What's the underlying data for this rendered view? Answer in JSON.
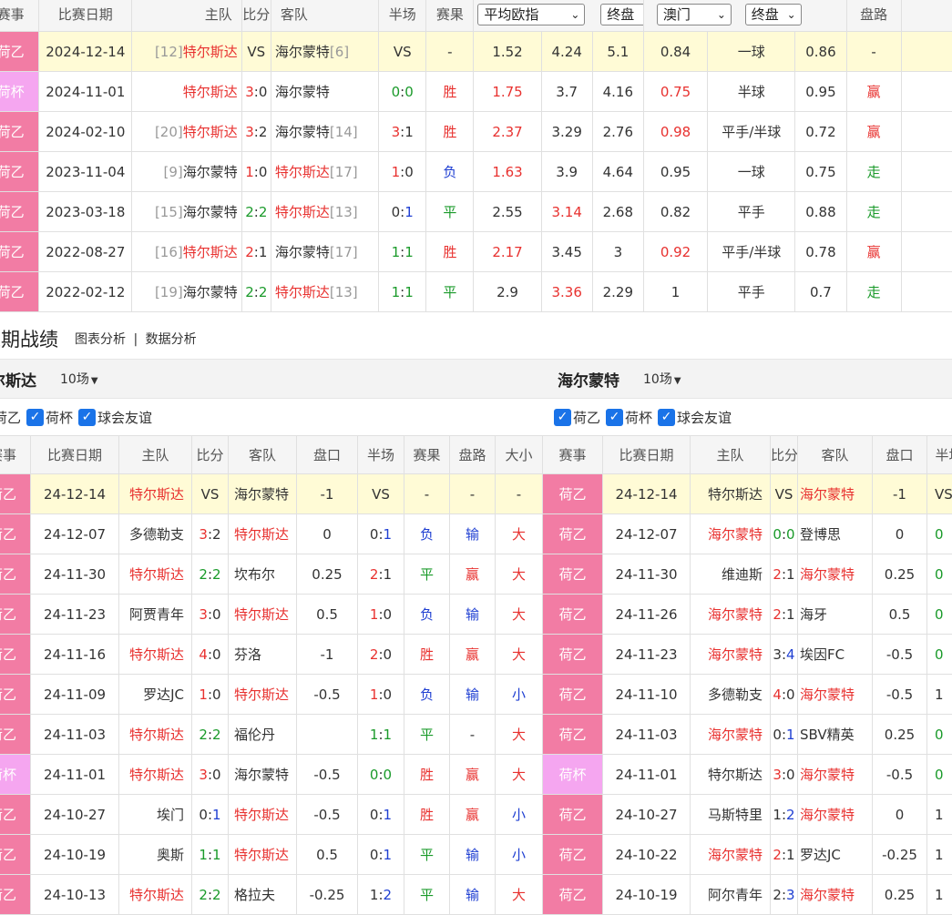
{
  "h2h": {
    "headers": {
      "league": "赛事",
      "date": "比赛日期",
      "home": "主队",
      "score": "比分",
      "away": "客队",
      "half": "半场",
      "result": "赛果",
      "odds_select": "平均欧指",
      "odds_type_select": "终盘",
      "company_select": "澳门",
      "handicap_type_select": "终盘",
      "trend": "盘路"
    },
    "rows": [
      {
        "league": "荷乙",
        "cup": false,
        "date": "2024-12-14",
        "home_rank": "[12]",
        "home": "特尔斯达",
        "home_red": true,
        "score_h": "VS",
        "score_a": "",
        "away": "海尔蒙特",
        "away_rank": "[6]",
        "away_red": false,
        "half": "VS",
        "half_h": "",
        "half_a": "",
        "result": "-",
        "result_c": "",
        "o1": "1.52",
        "o1c": "",
        "o2": "4.24",
        "o2c": "",
        "o3": "5.1",
        "o3c": "",
        "h1": "0.84",
        "h1c": "",
        "hcap": "一球",
        "h2": "0.86",
        "trend": "-",
        "trend_c": ""
      },
      {
        "league": "荷杯",
        "cup": true,
        "date": "2024-11-01",
        "home_rank": "",
        "home": "特尔斯达",
        "home_red": true,
        "score_h": "3",
        "score_a": "0",
        "away": "海尔蒙特",
        "away_rank": "",
        "away_red": false,
        "half": "",
        "half_h": "0",
        "half_a": "0",
        "result": "胜",
        "result_c": "red",
        "o1": "1.75",
        "o1c": "red",
        "o2": "3.7",
        "o2c": "",
        "o3": "4.16",
        "o3c": "",
        "h1": "0.75",
        "h1c": "red",
        "hcap": "半球",
        "h2": "0.95",
        "trend": "赢",
        "trend_c": "red"
      },
      {
        "league": "荷乙",
        "cup": false,
        "date": "2024-02-10",
        "home_rank": "[20]",
        "home": "特尔斯达",
        "home_red": true,
        "score_h": "3",
        "score_a": "2",
        "away": "海尔蒙特",
        "away_rank": "[14]",
        "away_red": false,
        "half": "",
        "half_h": "3",
        "half_a": "1",
        "result": "胜",
        "result_c": "red",
        "o1": "2.37",
        "o1c": "red",
        "o2": "3.29",
        "o2c": "",
        "o3": "2.76",
        "o3c": "",
        "h1": "0.98",
        "h1c": "red",
        "hcap": "平手/半球",
        "h2": "0.72",
        "trend": "赢",
        "trend_c": "red"
      },
      {
        "league": "荷乙",
        "cup": false,
        "date": "2023-11-04",
        "home_rank": "[9]",
        "home": "海尔蒙特",
        "home_red": false,
        "score_h": "1",
        "score_a": "0",
        "away": "特尔斯达",
        "away_rank": "[17]",
        "away_red": true,
        "half": "",
        "half_h": "1",
        "half_a": "0",
        "result": "负",
        "result_c": "blue",
        "o1": "1.63",
        "o1c": "red",
        "o2": "3.9",
        "o2c": "",
        "o3": "4.64",
        "o3c": "",
        "h1": "0.95",
        "h1c": "",
        "hcap": "一球",
        "h2": "0.75",
        "trend": "走",
        "trend_c": "green"
      },
      {
        "league": "荷乙",
        "cup": false,
        "date": "2023-03-18",
        "home_rank": "[15]",
        "home": "海尔蒙特",
        "home_red": false,
        "score_h": "2",
        "score_a": "2",
        "away": "特尔斯达",
        "away_rank": "[13]",
        "away_red": true,
        "half": "",
        "half_h": "0",
        "half_a": "1",
        "result": "平",
        "result_c": "green",
        "o1": "2.55",
        "o1c": "",
        "o2": "3.14",
        "o2c": "red",
        "o3": "2.68",
        "o3c": "",
        "h1": "0.82",
        "h1c": "",
        "hcap": "平手",
        "h2": "0.88",
        "trend": "走",
        "trend_c": "green"
      },
      {
        "league": "荷乙",
        "cup": false,
        "date": "2022-08-27",
        "home_rank": "[16]",
        "home": "特尔斯达",
        "home_red": true,
        "score_h": "2",
        "score_a": "1",
        "away": "海尔蒙特",
        "away_rank": "[17]",
        "away_red": false,
        "half": "",
        "half_h": "1",
        "half_a": "1",
        "result": "胜",
        "result_c": "red",
        "o1": "2.17",
        "o1c": "red",
        "o2": "3.45",
        "o2c": "",
        "o3": "3",
        "o3c": "",
        "h1": "0.92",
        "h1c": "red",
        "hcap": "平手/半球",
        "h2": "0.78",
        "trend": "赢",
        "trend_c": "red"
      },
      {
        "league": "荷乙",
        "cup": false,
        "date": "2022-02-12",
        "home_rank": "[19]",
        "home": "海尔蒙特",
        "home_red": false,
        "score_h": "2",
        "score_a": "2",
        "away": "特尔斯达",
        "away_rank": "[13]",
        "away_red": true,
        "half": "",
        "half_h": "1",
        "half_a": "1",
        "result": "平",
        "result_c": "green",
        "o1": "2.9",
        "o1c": "",
        "o2": "3.36",
        "o2c": "red",
        "o3": "2.29",
        "o3c": "",
        "h1": "1",
        "h1c": "",
        "hcap": "平手",
        "h2": "0.7",
        "trend": "走",
        "trend_c": "green"
      }
    ]
  },
  "section": {
    "title": "近期战绩",
    "link_chart": "图表分析",
    "sep": "|",
    "link_data": "数据分析"
  },
  "left": {
    "team": "特尔斯达",
    "count": "10场",
    "filters": [
      "荷乙",
      "荷杯",
      "球会友谊"
    ],
    "headers": [
      "赛事",
      "比赛日期",
      "主队",
      "比分",
      "客队",
      "盘口",
      "半场",
      "赛果",
      "盘路",
      "大小"
    ],
    "rows": [
      {
        "league": "荷乙",
        "cup": false,
        "date": "24-12-14",
        "home": "特尔斯达",
        "home_red": true,
        "sh": "VS",
        "sa": "",
        "away": "海尔蒙特",
        "away_red": false,
        "hcap": "-1",
        "half": "VS",
        "hh": "",
        "ha": "",
        "res": "-",
        "res_c": "",
        "trend": "-",
        "trend_c": "",
        "ou": "-",
        "ou_c": ""
      },
      {
        "league": "荷乙",
        "cup": false,
        "date": "24-12-07",
        "home": "多德勒支",
        "home_red": false,
        "sh": "3",
        "sa": "2",
        "away": "特尔斯达",
        "away_red": true,
        "hcap": "0",
        "half": "",
        "hh": "0",
        "ha": "1",
        "res": "负",
        "res_c": "blue",
        "trend": "输",
        "trend_c": "blue",
        "ou": "大",
        "ou_c": "red"
      },
      {
        "league": "荷乙",
        "cup": false,
        "date": "24-11-30",
        "home": "特尔斯达",
        "home_red": true,
        "sh": "2",
        "sa": "2",
        "away": "坎布尔",
        "away_red": false,
        "hcap": "0.25",
        "half": "",
        "hh": "2",
        "ha": "1",
        "res": "平",
        "res_c": "green",
        "trend": "赢",
        "trend_c": "red",
        "ou": "大",
        "ou_c": "red"
      },
      {
        "league": "荷乙",
        "cup": false,
        "date": "24-11-23",
        "home": "阿贾青年",
        "home_red": false,
        "sh": "3",
        "sa": "0",
        "away": "特尔斯达",
        "away_red": true,
        "hcap": "0.5",
        "half": "",
        "hh": "1",
        "ha": "0",
        "res": "负",
        "res_c": "blue",
        "trend": "输",
        "trend_c": "blue",
        "ou": "大",
        "ou_c": "red"
      },
      {
        "league": "荷乙",
        "cup": false,
        "date": "24-11-16",
        "home": "特尔斯达",
        "home_red": true,
        "sh": "4",
        "sa": "0",
        "away": "芬洛",
        "away_red": false,
        "hcap": "-1",
        "half": "",
        "hh": "2",
        "ha": "0",
        "res": "胜",
        "res_c": "red",
        "trend": "赢",
        "trend_c": "red",
        "ou": "大",
        "ou_c": "red"
      },
      {
        "league": "荷乙",
        "cup": false,
        "date": "24-11-09",
        "home": "罗达JC",
        "home_red": false,
        "sh": "1",
        "sa": "0",
        "away": "特尔斯达",
        "away_red": true,
        "hcap": "-0.5",
        "half": "",
        "hh": "1",
        "ha": "0",
        "res": "负",
        "res_c": "blue",
        "trend": "输",
        "trend_c": "blue",
        "ou": "小",
        "ou_c": "blue"
      },
      {
        "league": "荷乙",
        "cup": false,
        "date": "24-11-03",
        "home": "特尔斯达",
        "home_red": true,
        "sh": "2",
        "sa": "2",
        "away": "福伦丹",
        "away_red": false,
        "hcap": "",
        "half": "",
        "hh": "1",
        "ha": "1",
        "res": "平",
        "res_c": "green",
        "trend": "-",
        "trend_c": "",
        "ou": "大",
        "ou_c": "red"
      },
      {
        "league": "荷杯",
        "cup": true,
        "date": "24-11-01",
        "home": "特尔斯达",
        "home_red": true,
        "sh": "3",
        "sa": "0",
        "away": "海尔蒙特",
        "away_red": false,
        "hcap": "-0.5",
        "half": "",
        "hh": "0",
        "ha": "0",
        "res": "胜",
        "res_c": "red",
        "trend": "赢",
        "trend_c": "red",
        "ou": "大",
        "ou_c": "red"
      },
      {
        "league": "荷乙",
        "cup": false,
        "date": "24-10-27",
        "home": "埃门",
        "home_red": false,
        "sh": "0",
        "sa": "1",
        "away": "特尔斯达",
        "away_red": true,
        "hcap": "-0.5",
        "half": "",
        "hh": "0",
        "ha": "1",
        "res": "胜",
        "res_c": "red",
        "trend": "赢",
        "trend_c": "red",
        "ou": "小",
        "ou_c": "blue"
      },
      {
        "league": "荷乙",
        "cup": false,
        "date": "24-10-19",
        "home": "奥斯",
        "home_red": false,
        "sh": "1",
        "sa": "1",
        "away": "特尔斯达",
        "away_red": true,
        "hcap": "0.5",
        "half": "",
        "hh": "0",
        "ha": "1",
        "res": "平",
        "res_c": "green",
        "trend": "输",
        "trend_c": "blue",
        "ou": "小",
        "ou_c": "blue"
      },
      {
        "league": "荷乙",
        "cup": false,
        "date": "24-10-13",
        "home": "特尔斯达",
        "home_red": true,
        "sh": "2",
        "sa": "2",
        "away": "格拉夫",
        "away_red": false,
        "hcap": "-0.25",
        "half": "",
        "hh": "1",
        "ha": "2",
        "res": "平",
        "res_c": "green",
        "trend": "输",
        "trend_c": "blue",
        "ou": "大",
        "ou_c": "red"
      }
    ]
  },
  "right": {
    "team": "海尔蒙特",
    "count": "10场",
    "filters": [
      "荷乙",
      "荷杯",
      "球会友谊"
    ],
    "headers": [
      "赛事",
      "比赛日期",
      "主队",
      "比分",
      "客队",
      "盘口",
      "半场"
    ],
    "rows": [
      {
        "league": "荷乙",
        "cup": false,
        "date": "24-12-14",
        "home": "特尔斯达",
        "home_red": false,
        "sh": "VS",
        "sa": "",
        "away": "海尔蒙特",
        "away_red": true,
        "hcap": "-1",
        "half": "VS",
        "hh": "",
        "ha": ""
      },
      {
        "league": "荷乙",
        "cup": false,
        "date": "24-12-07",
        "home": "海尔蒙特",
        "home_red": true,
        "sh": "0",
        "sa": "0",
        "away": "登博思",
        "away_red": false,
        "hcap": "0",
        "half": "",
        "hh": "0",
        "ha": ""
      },
      {
        "league": "荷乙",
        "cup": false,
        "date": "24-11-30",
        "home": "维迪斯",
        "home_red": false,
        "sh": "2",
        "sa": "1",
        "away": "海尔蒙特",
        "away_red": true,
        "hcap": "0.25",
        "half": "",
        "hh": "0",
        "ha": ""
      },
      {
        "league": "荷乙",
        "cup": false,
        "date": "24-11-26",
        "home": "海尔蒙特",
        "home_red": true,
        "sh": "2",
        "sa": "1",
        "away": "海牙",
        "away_red": false,
        "hcap": "0.5",
        "half": "",
        "hh": "0",
        "ha": ""
      },
      {
        "league": "荷乙",
        "cup": false,
        "date": "24-11-23",
        "home": "海尔蒙特",
        "home_red": true,
        "sh": "3",
        "sa": "4",
        "away": "埃因FC",
        "away_red": false,
        "hcap": "-0.5",
        "half": "",
        "hh": "0",
        "ha": ""
      },
      {
        "league": "荷乙",
        "cup": false,
        "date": "24-11-10",
        "home": "多德勒支",
        "home_red": false,
        "sh": "4",
        "sa": "0",
        "away": "海尔蒙特",
        "away_red": true,
        "hcap": "-0.5",
        "half": "",
        "hh": "1",
        "ha": ""
      },
      {
        "league": "荷乙",
        "cup": false,
        "date": "24-11-03",
        "home": "海尔蒙特",
        "home_red": true,
        "sh": "0",
        "sa": "1",
        "away": "SBV精英",
        "away_red": false,
        "hcap": "0.25",
        "half": "",
        "hh": "0",
        "ha": ""
      },
      {
        "league": "荷杯",
        "cup": true,
        "date": "24-11-01",
        "home": "特尔斯达",
        "home_red": false,
        "sh": "3",
        "sa": "0",
        "away": "海尔蒙特",
        "away_red": true,
        "hcap": "-0.5",
        "half": "",
        "hh": "0",
        "ha": ""
      },
      {
        "league": "荷乙",
        "cup": false,
        "date": "24-10-27",
        "home": "马斯特里",
        "home_red": false,
        "sh": "1",
        "sa": "2",
        "away": "海尔蒙特",
        "away_red": true,
        "hcap": "0",
        "half": "",
        "hh": "1",
        "ha": ""
      },
      {
        "league": "荷乙",
        "cup": false,
        "date": "24-10-22",
        "home": "海尔蒙特",
        "home_red": true,
        "sh": "2",
        "sa": "1",
        "away": "罗达JC",
        "away_red": false,
        "hcap": "-0.25",
        "half": "",
        "hh": "1",
        "ha": ""
      },
      {
        "league": "荷乙",
        "cup": false,
        "date": "24-10-19",
        "home": "阿尔青年",
        "home_red": false,
        "sh": "2",
        "sa": "3",
        "away": "海尔蒙特",
        "away_red": true,
        "hcap": "0.25",
        "half": "",
        "hh": "1",
        "ha": ""
      }
    ]
  }
}
